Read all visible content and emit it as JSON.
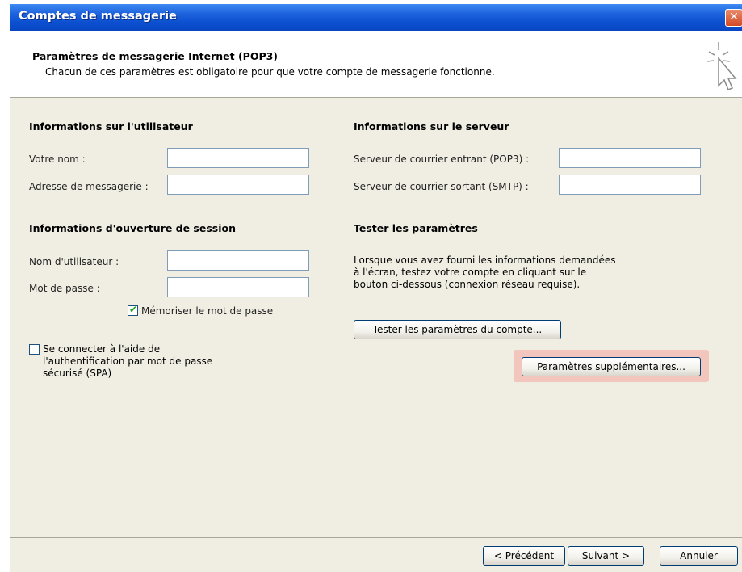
{
  "window": {
    "title": "Comptes de messagerie",
    "close_glyph": "✕"
  },
  "header": {
    "title": "Paramètres de messagerie Internet (POP3)",
    "subtitle": "Chacun de ces paramètres est obligatoire pour que votre compte de messagerie fonctionne.",
    "icon": "cursor-click-icon"
  },
  "user_info": {
    "heading": "Informations sur l'utilisateur",
    "name_label": "Votre nom :",
    "name_value": "",
    "email_label": "Adresse de messagerie :",
    "email_value": ""
  },
  "server_info": {
    "heading": "Informations sur le serveur",
    "incoming_label": "Serveur de courrier entrant (POP3) :",
    "incoming_value": "",
    "outgoing_label": "Serveur de courrier sortant (SMTP) :",
    "outgoing_value": ""
  },
  "logon_info": {
    "heading": "Informations d'ouverture de session",
    "username_label": "Nom d'utilisateur :",
    "username_value": "",
    "password_label": "Mot de passe :",
    "password_value": "",
    "remember_label": "Mémoriser le mot de passe",
    "remember_checked": true,
    "spa_label_line1": "Se connecter à l'aide de",
    "spa_label_line2": "l'authentification par mot de passe",
    "spa_label_line3": "sécurisé (SPA)",
    "spa_checked": false
  },
  "test_settings": {
    "heading": "Tester les paramètres",
    "line1": "Lorsque vous avez fourni les informations demandées",
    "line2": "à l'écran, testez votre compte en cliquant sur le",
    "line3": "bouton ci-dessous (connexion réseau requise).",
    "test_button": "Tester les paramètres du compte...",
    "more_settings_button": "Paramètres supplémentaires..."
  },
  "footer": {
    "back_button": "< Précédent",
    "next_button": "Suivant >",
    "cancel_button": "Annuler"
  },
  "colors": {
    "titlebar": "#0b4fd0",
    "dialog_bg": "#f0eee3",
    "highlight": "#f2c6bd"
  }
}
